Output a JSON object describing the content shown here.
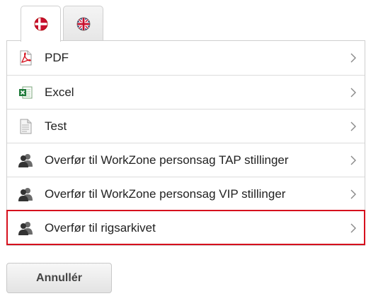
{
  "tabs": [
    {
      "name": "danish",
      "icon": "danish-flag-icon",
      "active": true
    },
    {
      "name": "english",
      "icon": "uk-flag-icon",
      "active": false
    }
  ],
  "menu": {
    "items": [
      {
        "label": "PDF",
        "icon": "pdf-file-icon"
      },
      {
        "label": "Excel",
        "icon": "excel-file-icon"
      },
      {
        "label": "Test",
        "icon": "text-file-icon"
      },
      {
        "label": "Overfør til WorkZone personsag TAP stillinger",
        "icon": "users-icon"
      },
      {
        "label": "Overfør til WorkZone personsag VIP stillinger",
        "icon": "users-icon"
      },
      {
        "label": "Overfør til rigsarkivet",
        "icon": "users-icon",
        "highlighted": true
      }
    ]
  },
  "actions": {
    "cancel_label": "Annullér"
  },
  "colors": {
    "highlight": "#d6101d",
    "danish_red": "#c8102e",
    "uk_blue": "#012169",
    "uk_red": "#c8102e"
  }
}
